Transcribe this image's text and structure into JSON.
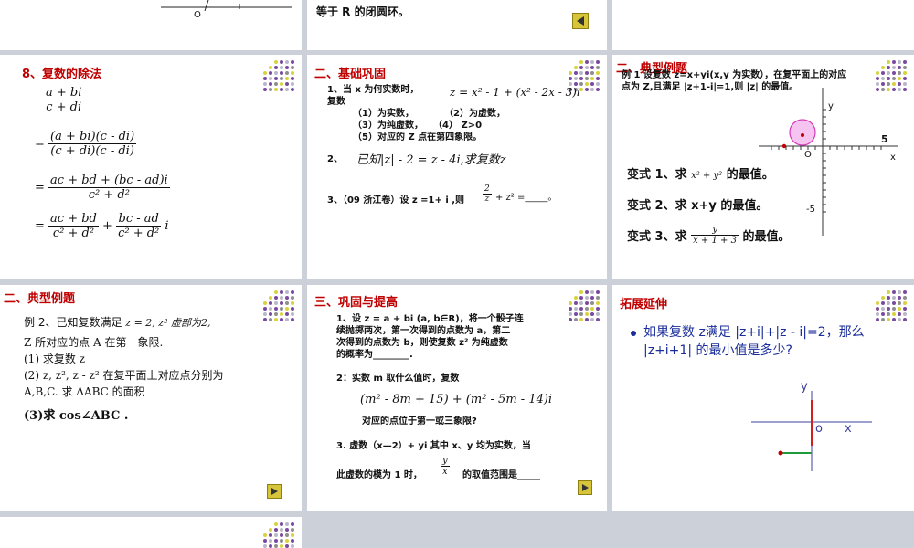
{
  "slide_top_right": {
    "text": "等于 R 的闭圆环。",
    "axis_label": "O"
  },
  "slide_division": {
    "title": "8、复数的除法",
    "step0_num": "a + bi",
    "step0_den": "c + di",
    "step1_num": "(a + bi)(c - di)",
    "step1_den": "(c + di)(c - di)",
    "step2_num": "ac + bd + (bc - ad)i",
    "step2_den": "c² + d²",
    "step3_num1": "ac + bd",
    "step3_den1": "c² + d²",
    "step3_num2": "bc - ad",
    "step3_den2": "c² + d²",
    "step3_tail": "i"
  },
  "slide_basic": {
    "title": "二、基础巩固",
    "q1_lead": "1、当 x 为何实数时，复数",
    "q1_formula": "z = x² - 1 + (x² - 2x - 3)i",
    "q1_parts": [
      "（1）为实数，",
      "（2）为虚数，",
      "（3）为纯虚数，",
      "（4） Z>0",
      "（5）对应的 Z 点在第四象限。"
    ],
    "q2_num": "2、",
    "q2_text": "已知|z| - 2 = z - 4i,求复数z",
    "q3_text": "3、（09 浙江卷）设 z =1+ i ,则",
    "q3_tail": "+ z² =_____。"
  },
  "slide_typical1": {
    "title": "二、典型例题",
    "example": "例 1 设复数 z=x+yi(x,y 为实数），在复平面上的对应点为 Z,且满足 |z+1-i|=1,则 |z| 的最值。",
    "axis_y": "y",
    "axis_x": "x",
    "axis_o": "O",
    "tick5": "5",
    "tickm5": "-5",
    "v1": "变式 1、求",
    "v1_expr": "x² + y²",
    "v1_tail": "的最值。",
    "v2": "变式 2、求 x+y 的最值。",
    "v3": "变式 3、求",
    "v3_num": "y",
    "v3_den": "x + 1 + 3",
    "v3_tail": "的最值。"
  },
  "slide_typical2": {
    "title": "二、典型例题",
    "line1_a": "例 2、已知复数满足",
    "line1_b": "z = 2, z² 虚部为2,",
    "line2": "Z 所对应的点 A 在第一象限.",
    "line3": "(1) 求复数 z",
    "line4": "(2) z, z², z - z² 在复平面上对应点分别为",
    "line5": "A,B,C. 求 ΔABC 的面积",
    "line6": "(3)求 cos∠ABC ."
  },
  "slide_consolidate": {
    "title": "三、巩固与提高",
    "p1_a": "1、设 z = a + bi (a, b∈R)，将一个骰子连",
    "p1_b": "续抛掷两次，第一次得到的点数为 a，第二",
    "p1_c": "次得到的点数为 b，则使复数 z² 为纯虚数",
    "p1_d": "的概率为________.",
    "p2": "2：实数 m 取什么值时，复数",
    "p2_formula": "(m² - 8m + 15) + (m² - 5m - 14)i",
    "p2_tail": "对应的点位于第一或三象限?",
    "p3": "3. 虚数（x—2）+ yi 其中 x、y 均为实数，当",
    "p3_b": "此虚数的模为 1 时，",
    "p3_num": "y",
    "p3_den": "x",
    "p3_tail": "的取值范围是_____"
  },
  "slide_extend": {
    "title": "拓展延伸",
    "text": "如果复数 z满足 |z+i|+|z - i|=2，那么 |z+i+1| 的最小值是多少?",
    "axis_y": "y",
    "axis_x": "x",
    "axis_o": "o"
  },
  "colors": {
    "title_red": "#c00000",
    "body_blue": "#1a2d9a",
    "button_gold": "#d6c53a",
    "background": "#ccd1d9"
  }
}
